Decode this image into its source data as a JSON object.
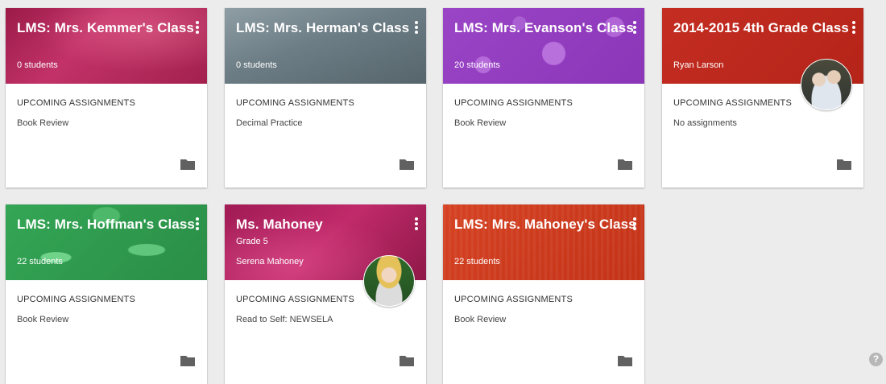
{
  "cards": [
    {
      "title": "LMS: Mrs. Kemmer's Class",
      "subtitle": "",
      "count": "0 students",
      "section": "UPCOMING ASSIGNMENTS",
      "assignment": "Book Review"
    },
    {
      "title": "LMS: Mrs. Herman's Class",
      "subtitle": "",
      "count": "0 students",
      "section": "UPCOMING ASSIGNMENTS",
      "assignment": "Decimal Practice"
    },
    {
      "title": "LMS: Mrs. Evanson's Class",
      "subtitle": "",
      "count": "20 students",
      "section": "UPCOMING ASSIGNMENTS",
      "assignment": "Book Review"
    },
    {
      "title": "2014-2015 4th Grade Class",
      "subtitle": "",
      "count": "Ryan Larson",
      "section": "UPCOMING ASSIGNMENTS",
      "assignment": "No assignments"
    },
    {
      "title": "LMS: Mrs. Hoffman's Class",
      "subtitle": "",
      "count": "22 students",
      "section": "UPCOMING ASSIGNMENTS",
      "assignment": "Book Review"
    },
    {
      "title": "Ms. Mahoney",
      "subtitle": "Grade 5",
      "count": "Serena Mahoney",
      "section": "UPCOMING ASSIGNMENTS",
      "assignment": "Read to Self: NEWSELA"
    },
    {
      "title": "LMS: Mrs. Mahoney's Class",
      "subtitle": "",
      "count": "22 students",
      "section": "UPCOMING ASSIGNMENTS",
      "assignment": "Book Review"
    }
  ],
  "icons": {
    "menu": "more-vert-icon",
    "folder": "folder-icon",
    "help": "help-icon"
  },
  "help_label": "?"
}
